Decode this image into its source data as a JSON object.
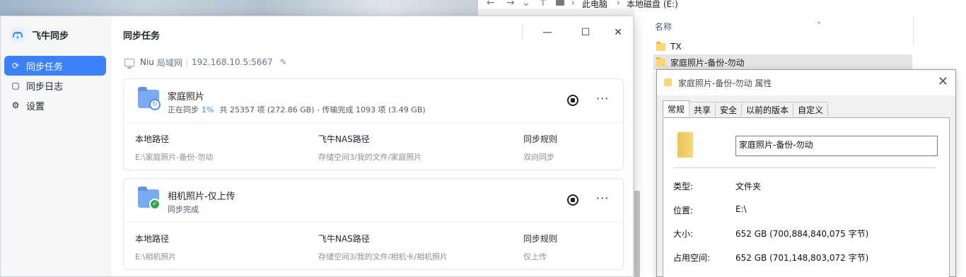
{
  "explorer": {
    "breadcrumb": [
      "此电脑",
      "本地磁盘 (E:)"
    ],
    "column_name": "名称",
    "files": [
      {
        "name": "TX",
        "selected": false
      },
      {
        "name": "家庭照片-备份-勿动",
        "selected": true
      }
    ]
  },
  "properties": {
    "title": "家庭照片-备份-勿动 属性",
    "tabs": [
      "常规",
      "共享",
      "安全",
      "以前的版本",
      "自定义"
    ],
    "active_tab": "常规",
    "name_value": "家庭照片-备份-勿动",
    "rows": [
      {
        "key": "类型:",
        "value": "文件夹"
      },
      {
        "key": "位置:",
        "value": "E:\\"
      },
      {
        "key": "大小:",
        "value": "652 GB (700,884,840,075 字节)"
      },
      {
        "key": "占用空间:",
        "value": "652 GB (701,148,803,072 字节)"
      }
    ]
  },
  "app": {
    "name": "飞牛同步",
    "nav": [
      {
        "label": "同步任务",
        "icon": "sync-icon",
        "active": true
      },
      {
        "label": "同步日志",
        "icon": "log-icon",
        "active": false
      },
      {
        "label": "设置",
        "icon": "gear-icon",
        "active": false
      }
    ],
    "page_title": "同步任务",
    "device": {
      "name": "Niu",
      "network": "局域网",
      "ip": "192.168.10.5:5667"
    },
    "tasks": [
      {
        "name": "家庭照片",
        "status": "正在同步",
        "progress": "1%",
        "detail": "共 25357 项 (272.86 GB) - 传输完成 1093 项 (3.49 GB)",
        "badge": "syncing",
        "local_label": "本地路径",
        "local_path": "E:\\家庭照片-备份-勿动",
        "nas_label": "飞牛NAS路径",
        "nas_path": "存储空间3/我的文件/家庭照片",
        "rule_label": "同步规则",
        "rule": "双向同步"
      },
      {
        "name": "相机照片-仅上传",
        "status": "同步完成",
        "progress": "",
        "detail": "",
        "badge": "done",
        "local_label": "本地路径",
        "local_path": "E:\\相机照片",
        "nas_label": "飞牛NAS路径",
        "nas_path": "存储空间3/我的文件/相机卡/相机照片",
        "rule_label": "同步规则",
        "rule": "仅上传"
      }
    ]
  },
  "colors": {
    "accent": "#3b82f6",
    "success": "#2eaa4a",
    "folder_blue": "#7aaaf2",
    "folder_yellow": "#f8d775"
  }
}
